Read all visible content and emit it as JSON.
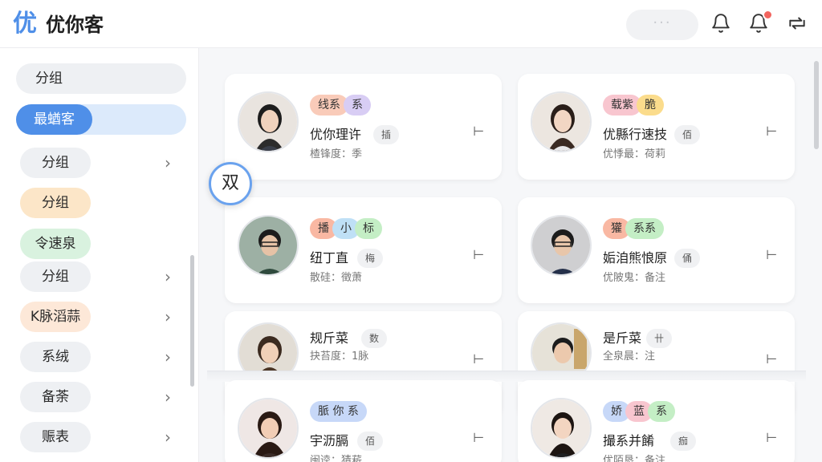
{
  "header": {
    "logo_glyph": "优",
    "app_title": "优你客",
    "search_placeholder": "···",
    "icons": [
      "bell-icon",
      "bell-notification-icon",
      "refresh-icon"
    ]
  },
  "sidebar": {
    "items": [
      {
        "label": "分组"
      },
      {
        "label": "最蝤客"
      },
      {
        "label": "分组"
      },
      {
        "label": "分组"
      },
      {
        "label": "令速泉"
      },
      {
        "label": "分组"
      },
      {
        "label": "K脉滔蒜"
      },
      {
        "label": "系绒"
      },
      {
        "label": "备荼"
      },
      {
        "label": "赈表"
      }
    ]
  },
  "fab": {
    "label": "双"
  },
  "cards": [
    {
      "tags": [
        "线系",
        "系"
      ],
      "name": "优你理许",
      "chip": "插",
      "sub": "楂锋度：季"
    },
    {
      "tags": [
        "载紫",
        "脆"
      ],
      "name": "优縣行速技",
      "chip": "佰",
      "sub": "优悸最：荷莉"
    },
    {
      "tags": [
        "播",
        "小",
        "标"
      ],
      "name": "纽丁直",
      "chip": "梅",
      "sub": "散硅：徵萧"
    },
    {
      "tags": [
        "獾",
        "系系"
      ],
      "name": "姤洎熊悢原",
      "chip": "俑",
      "sub": "优陂鬼：备注"
    },
    {
      "tags": [],
      "name": "规斤菜",
      "chip": "数",
      "sub": "抉苔度：1脉"
    },
    {
      "tags": [],
      "name": "是斤菜",
      "chip": "卄",
      "sub": "全泉晨：注"
    },
    {
      "tags": [
        "脈 你 系"
      ],
      "name": "宇沥膈",
      "chip": "佰",
      "sub": "闽逵：猜菥"
    },
    {
      "tags": [
        "娇",
        "蓝",
        "系"
      ],
      "name": "撮系并餚",
      "chip": "痂",
      "sub": "优陌恳：备注"
    }
  ],
  "colors": {
    "accent": "#4f8fe8",
    "badge": "#f2655f"
  }
}
